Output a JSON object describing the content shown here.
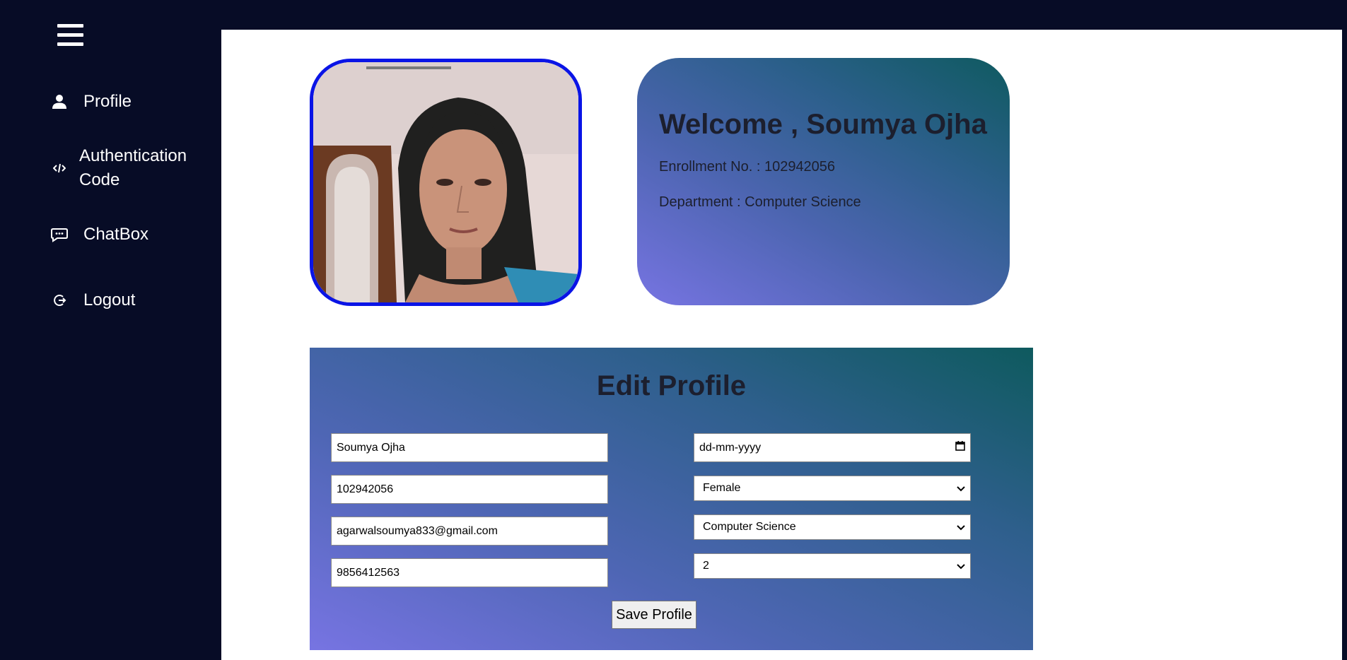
{
  "sidebar": {
    "menu_icon": "hamburger-menu-icon",
    "items": [
      {
        "label": "Profile",
        "icon": "user-icon"
      },
      {
        "label": "Authentication Code",
        "icon": "code-icon"
      },
      {
        "label": "ChatBox",
        "icon": "chat-bubble-icon"
      },
      {
        "label": "Logout",
        "icon": "logout-icon"
      }
    ]
  },
  "welcome": {
    "title": "Welcome , Soumya Ojha",
    "enrollment": "Enrollment No. : 102942056",
    "department": "Department : Computer Science"
  },
  "edit_profile": {
    "title": "Edit Profile",
    "name": "Soumya Ojha",
    "enrollment_no": "102942056",
    "email": "agarwalsoumya833@gmail.com",
    "phone": "9856412563",
    "dob_placeholder": "dd-mm-yyyy",
    "gender": "Female",
    "department": "Computer Science",
    "year": "2",
    "save_label": "Save Profile"
  },
  "colors": {
    "sidebar_bg": "#070c26",
    "photo_border": "#0a14e6",
    "gradient_start": "#7774e2",
    "gradient_end": "#0e5a5e"
  }
}
